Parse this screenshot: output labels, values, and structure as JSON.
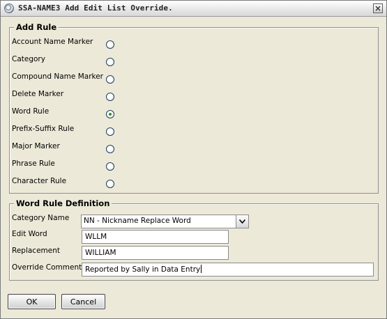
{
  "window": {
    "title": "SSA-NAME3 Add Edit List Override.",
    "icon": "app-globe-icon",
    "close_icon": "close-icon"
  },
  "add_rule": {
    "title": "Add Rule",
    "options": [
      {
        "label": "Account Name Marker",
        "checked": false
      },
      {
        "label": "Category",
        "checked": false
      },
      {
        "label": "Compound Name Marker",
        "checked": false
      },
      {
        "label": "Delete Marker",
        "checked": false
      },
      {
        "label": "Word Rule",
        "checked": true
      },
      {
        "label": "Prefix-Suffix Rule",
        "checked": false
      },
      {
        "label": "Major Marker",
        "checked": false
      },
      {
        "label": "Phrase Rule",
        "checked": false
      },
      {
        "label": "Character Rule",
        "checked": false
      }
    ]
  },
  "word_rule": {
    "title": "Word Rule Definition",
    "category_label": "Category Name",
    "category_value": "NN - Nickname Replace Word",
    "edit_word_label": "Edit Word",
    "edit_word_value": "WLLM",
    "replacement_label": "Replacement",
    "replacement_value": "WILLIAM",
    "comment_label": "Override Comment",
    "comment_value": "Reported by Sally in Data Entry"
  },
  "buttons": {
    "ok": "OK",
    "cancel": "Cancel"
  }
}
